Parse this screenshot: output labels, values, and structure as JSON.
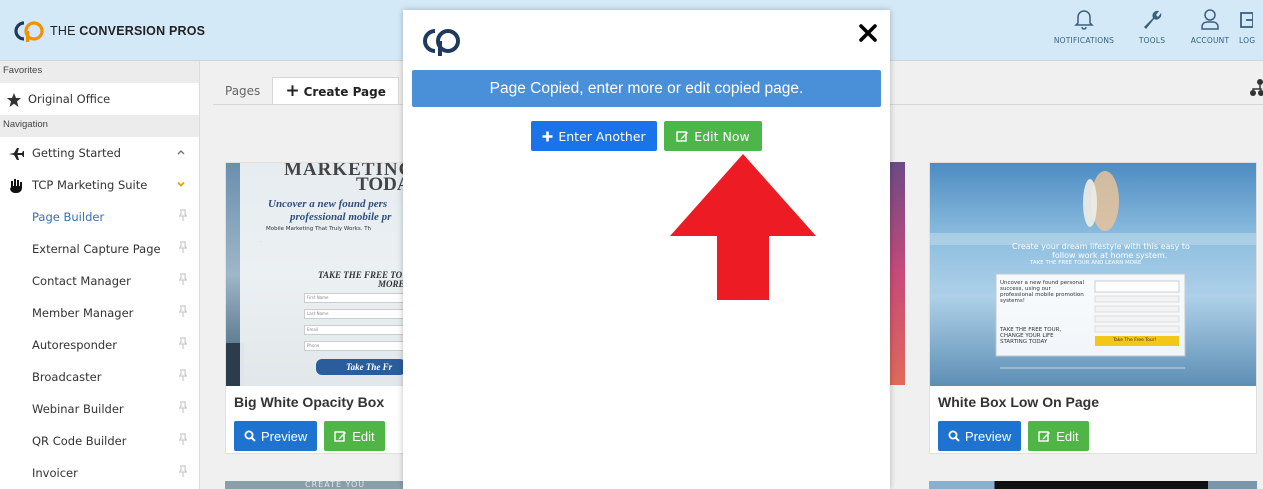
{
  "header": {
    "brand": "THE CONVERSION PROS",
    "brand_prefix": "THE ",
    "brand_bold": "CONVERSION PROS",
    "actions": [
      {
        "label": "NOTIFICATIONS",
        "icon": "bell-icon"
      },
      {
        "label": "TOOLS",
        "icon": "wrench-icon"
      },
      {
        "label": "ACCOUNT",
        "icon": "user-icon"
      },
      {
        "label": "LOG",
        "icon": "logout-icon"
      }
    ]
  },
  "sidebar": {
    "favorites_heading": "Favorites",
    "favorites": [
      {
        "label": "Original Office",
        "icon": "star-icon"
      }
    ],
    "navigation_heading": "Navigation",
    "sections": [
      {
        "label": "Getting Started",
        "icon": "plane-icon",
        "expanded": false
      },
      {
        "label": "TCP Marketing Suite",
        "icon": "hand-icon",
        "expanded": true
      }
    ],
    "items": [
      {
        "label": "Page Builder",
        "active": true
      },
      {
        "label": "External Capture Page"
      },
      {
        "label": "Contact Manager"
      },
      {
        "label": "Member Manager"
      },
      {
        "label": "Autoresponder"
      },
      {
        "label": "Broadcaster"
      },
      {
        "label": "Webinar Builder"
      },
      {
        "label": "QR Code Builder"
      },
      {
        "label": "Invoicer"
      }
    ]
  },
  "main": {
    "tabs": [
      {
        "label": "Pages"
      },
      {
        "label": "Create Page",
        "active": true
      }
    ],
    "cards": [
      {
        "title": "Big White Opacity Box",
        "preview_label": "Preview",
        "edit_label": "Edit",
        "thumb": {
          "headline": "MARKETING",
          "headline2": "TODA",
          "italic1": "Uncover a new found pers",
          "italic2": "professional mobile pr",
          "line": "Mobile Marketing That Truly Works. Th",
          "cta": "TAKE THE FREE TO",
          "cta2": "MORE",
          "fields": [
            "First Name",
            "Last Name",
            "Email",
            "Phone"
          ],
          "button": "Take The Fr"
        }
      },
      {
        "title": "White Box Low On Page",
        "preview_label": "Preview",
        "edit_label": "Edit",
        "thumb": {
          "line1": "Create your dream lifestyle with this easy to",
          "line2": "follow work at home system.",
          "line3": "TAKE THE FREE TOUR AND LEARN MORE",
          "box_text1": "Uncover a new found personal",
          "box_text2": "success, using our",
          "box_text3": "professional mobile promotion",
          "box_text4": "systems!",
          "box_text5": "TAKE THE FREE TOUR,",
          "box_text6": "CHANGE YOUR LIFE",
          "box_text7": "STARTING TODAY",
          "box_button": "Take The Free Tour!"
        }
      }
    ],
    "bottom_text": "CREATE YOU"
  },
  "modal": {
    "message": "Page Copied, enter more or edit copied page.",
    "enter_another_label": "Enter Another",
    "edit_now_label": "Edit Now",
    "close_icon": "close-icon"
  },
  "colors": {
    "header_bg": "#d4e9f8",
    "banner_blue": "#4a90d9",
    "button_blue": "#1a73e8",
    "button_green": "#4cb648",
    "arrow_red": "#ed1c24",
    "logo_orange": "#f39200"
  }
}
